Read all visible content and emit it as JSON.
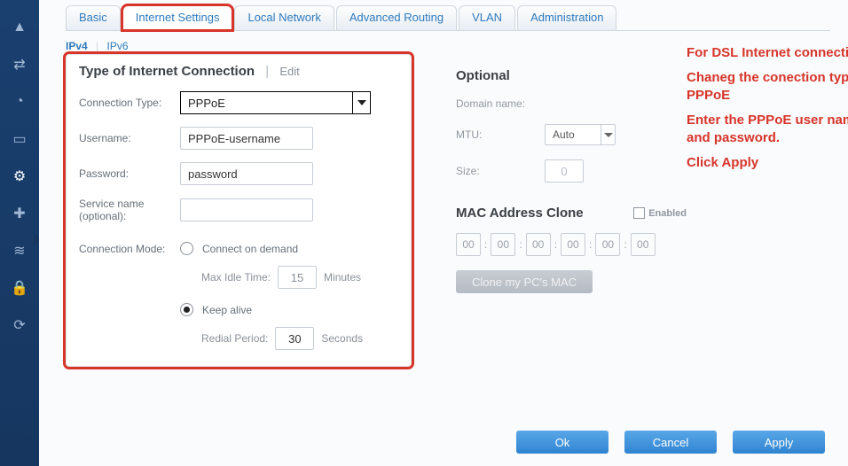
{
  "sidebar": {
    "items": [
      {
        "icon": "▲",
        "name": "nav-alert"
      },
      {
        "icon": "⇄",
        "name": "nav-transfer"
      },
      {
        "icon": "◔",
        "name": "nav-monitor"
      },
      {
        "icon": "▭",
        "name": "nav-device"
      },
      {
        "icon": "⚙",
        "name": "nav-settings"
      },
      {
        "icon": "✚",
        "name": "nav-diagnostics"
      },
      {
        "icon": "≋",
        "name": "nav-wireless"
      },
      {
        "icon": "🔒",
        "name": "nav-security"
      },
      {
        "icon": "⟳",
        "name": "nav-refresh"
      }
    ],
    "active_index": 4
  },
  "tabs": [
    {
      "label": "Basic",
      "active": false,
      "highlight": false
    },
    {
      "label": "Internet Settings",
      "active": true,
      "highlight": true
    },
    {
      "label": "Local Network",
      "active": false,
      "highlight": false
    },
    {
      "label": "Advanced Routing",
      "active": false,
      "highlight": false
    },
    {
      "label": "VLAN",
      "active": false,
      "highlight": false
    },
    {
      "label": "Administration",
      "active": false,
      "highlight": false
    }
  ],
  "subtabs": {
    "ipv4": "IPv4",
    "ipv6": "IPv6"
  },
  "panel": {
    "title": "Type of Internet Connection",
    "edit": "Edit",
    "connection_type_label": "Connection Type:",
    "connection_type_value": "PPPoE",
    "username_label": "Username:",
    "username_value": "PPPoE-username",
    "password_label": "Password:",
    "password_value": "password",
    "service_label": "Service name (optional):",
    "service_value": "",
    "connection_mode_label": "Connection Mode:",
    "connect_on_demand": "Connect on demand",
    "max_idle_label": "Max Idle Time:",
    "max_idle_value": "15",
    "max_idle_unit": "Minutes",
    "keep_alive": "Keep alive",
    "redial_label": "Redial Period:",
    "redial_value": "30",
    "redial_unit": "Seconds",
    "mode_selected": "keep_alive"
  },
  "optional": {
    "title": "Optional",
    "domain_label": "Domain name:",
    "mtu_label": "MTU:",
    "mtu_value": "Auto",
    "size_label": "Size:",
    "size_value": "0"
  },
  "mac": {
    "title": "MAC Address Clone",
    "enabled_label": "Enabled",
    "octets": [
      "00",
      "00",
      "00",
      "00",
      "00",
      "00"
    ],
    "clone_btn": "Clone my PC's MAC"
  },
  "buttons": {
    "ok": "Ok",
    "cancel": "Cancel",
    "apply": "Apply"
  },
  "annotation": {
    "l1": "For DSL Internet connection-",
    "l2": "Chaneg the conection type to PPPoE",
    "l3": "Enter the PPPoE user name and password.",
    "l4": "Click Apply"
  }
}
